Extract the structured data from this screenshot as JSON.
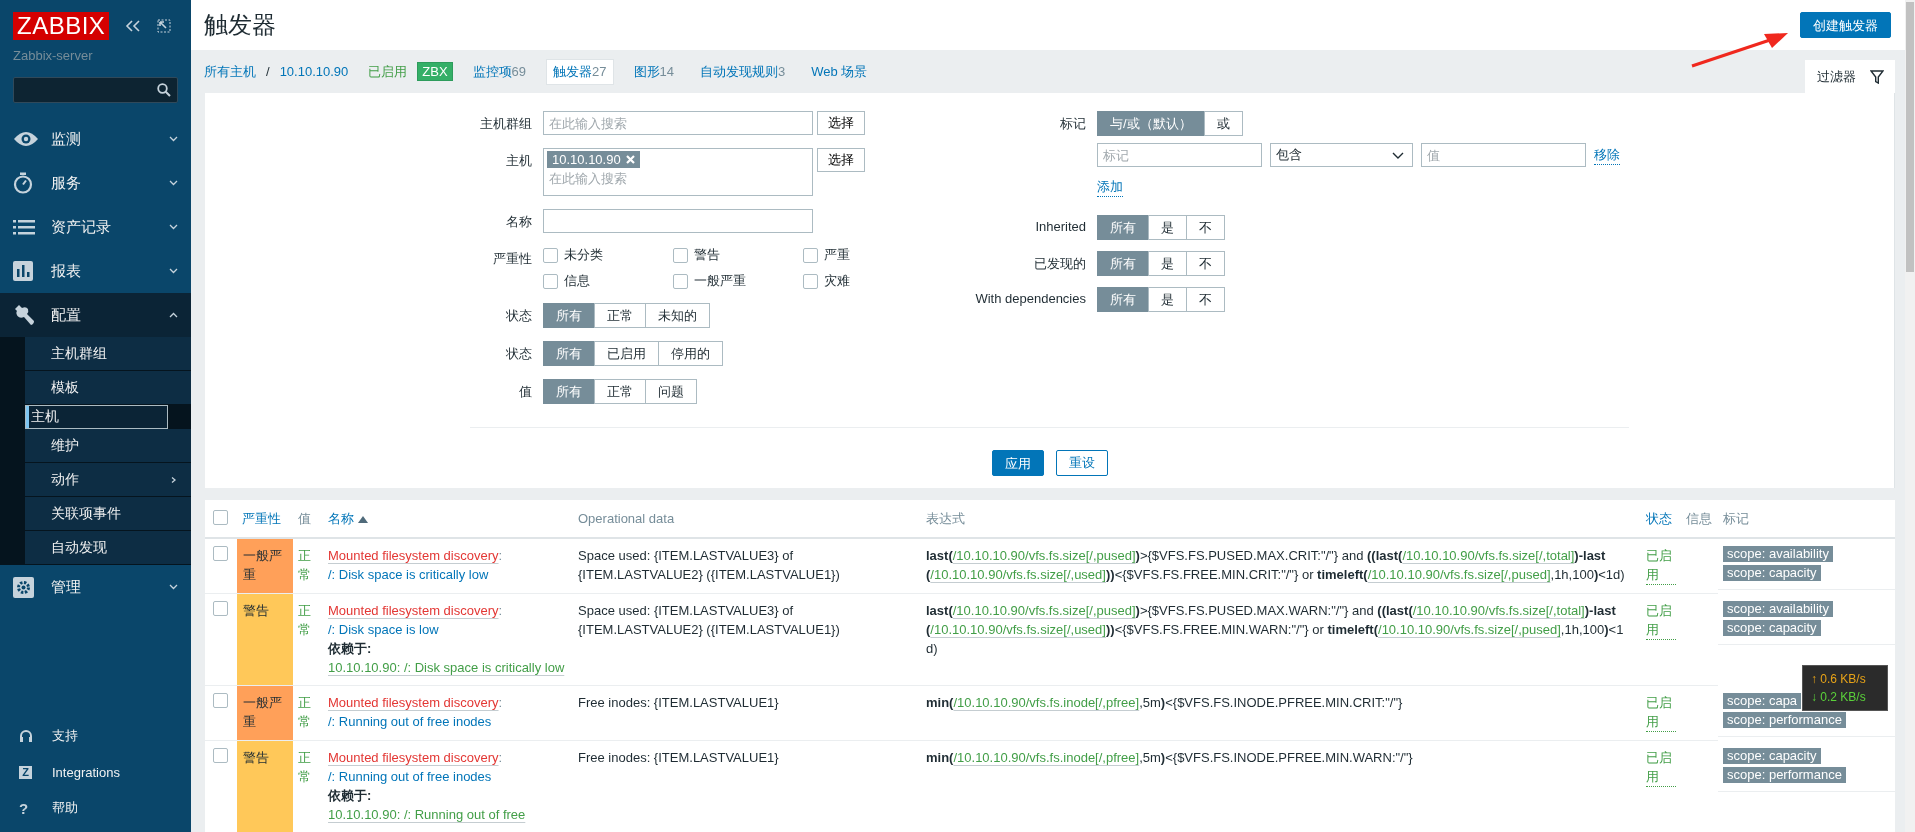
{
  "sidebar": {
    "logo": "ZABBIX",
    "server": "Zabbix-server",
    "menu": [
      {
        "label": "监测",
        "expanded": false
      },
      {
        "label": "服务",
        "expanded": false
      },
      {
        "label": "资产记录",
        "expanded": false
      },
      {
        "label": "报表",
        "expanded": false
      },
      {
        "label": "配置",
        "expanded": true,
        "children": [
          {
            "label": "主机群组",
            "selected": false,
            "has_submenu": false
          },
          {
            "label": "模板",
            "selected": false,
            "has_submenu": false
          },
          {
            "label": "主机",
            "selected": true,
            "has_submenu": false
          },
          {
            "label": "维护",
            "selected": false,
            "has_submenu": false
          },
          {
            "label": "动作",
            "selected": false,
            "has_submenu": true
          },
          {
            "label": "关联项事件",
            "selected": false,
            "has_submenu": false
          },
          {
            "label": "自动发现",
            "selected": false,
            "has_submenu": false
          }
        ]
      },
      {
        "label": "管理",
        "expanded": false
      }
    ],
    "bottom": [
      {
        "label": "支持"
      },
      {
        "label": "Integrations",
        "glyph": "Z"
      },
      {
        "label": "帮助",
        "glyph": "?"
      }
    ]
  },
  "header": {
    "title": "触发器",
    "create_button": "创建触发器"
  },
  "nav": {
    "breadcrumbs": [
      "所有主机",
      "10.10.10.90"
    ],
    "separator": "/",
    "status": "已启用",
    "badge": "ZBX",
    "tabs": [
      {
        "label": "监控项",
        "count": "69",
        "selected": false
      },
      {
        "label": "触发器",
        "count": "27",
        "selected": true
      },
      {
        "label": "图形",
        "count": "14",
        "selected": false
      },
      {
        "label": "自动发现规则",
        "count": "3",
        "selected": false
      },
      {
        "label": "Web 场景",
        "selected": false
      }
    ],
    "filter_tab": "过滤器"
  },
  "filter": {
    "host_group": {
      "label": "主机群组",
      "placeholder": "在此输入搜索",
      "button": "选择"
    },
    "host": {
      "label": "主机",
      "chips": [
        "10.10.10.90"
      ],
      "placeholder": "在此输入搜索",
      "button": "选择"
    },
    "name": {
      "label": "名称"
    },
    "severity": {
      "label": "严重性",
      "options": [
        {
          "label": "未分类",
          "checked": false
        },
        {
          "label": "警告",
          "checked": false
        },
        {
          "label": "严重",
          "checked": false
        },
        {
          "label": "信息",
          "checked": false
        },
        {
          "label": "一般严重",
          "checked": false
        },
        {
          "label": "灾难",
          "checked": false
        }
      ]
    },
    "segments_left": [
      {
        "label": "状态",
        "options": [
          {
            "label": "所有",
            "selected": true
          },
          {
            "label": "正常",
            "selected": false
          },
          {
            "label": "未知的",
            "selected": false
          }
        ]
      },
      {
        "label": "状态",
        "options": [
          {
            "label": "所有",
            "selected": true
          },
          {
            "label": "已启用",
            "selected": false
          },
          {
            "label": "停用的",
            "selected": false
          }
        ]
      },
      {
        "label": "值",
        "options": [
          {
            "label": "所有",
            "selected": true
          },
          {
            "label": "正常",
            "selected": false
          },
          {
            "label": "问题",
            "selected": false
          }
        ]
      }
    ],
    "tags": {
      "label": "标记",
      "options": [
        {
          "label": "与/或（默认）",
          "selected": true
        },
        {
          "label": "或",
          "selected": false
        }
      ],
      "tag_placeholder": "标记",
      "operator": "包含",
      "value_placeholder": "值",
      "remove": "移除",
      "add": "添加"
    },
    "segments_right": [
      {
        "label": "Inherited",
        "options": [
          {
            "label": "所有",
            "selected": true
          },
          {
            "label": "是",
            "selected": false
          },
          {
            "label": "不",
            "selected": false
          }
        ]
      },
      {
        "label": "已发现的",
        "options": [
          {
            "label": "所有",
            "selected": true
          },
          {
            "label": "是",
            "selected": false
          },
          {
            "label": "不",
            "selected": false
          }
        ]
      },
      {
        "label": "With dependencies",
        "options": [
          {
            "label": "所有",
            "selected": true
          },
          {
            "label": "是",
            "selected": false
          },
          {
            "label": "不",
            "selected": false
          }
        ]
      }
    ],
    "apply": "应用",
    "reset": "重设"
  },
  "table": {
    "select_all": {
      "checked": false
    },
    "columns": [
      {
        "label": "严重性",
        "sortable": true
      },
      {
        "label": "值",
        "sortable": false
      },
      {
        "label": "名称",
        "sortable": true,
        "sort_ascending": true
      },
      {
        "label": "Operational data",
        "sortable": false
      },
      {
        "label": "表达式",
        "sortable": false
      },
      {
        "label": "状态",
        "sortable": true
      },
      {
        "label": "信息",
        "sortable": false
      },
      {
        "label": "标记",
        "sortable": false
      }
    ],
    "rows": [
      {
        "checked": false,
        "severity": "一般严重",
        "color": "#ffa059",
        "value": "正常",
        "template": "Mounted filesystem discovery",
        "separator": ":",
        "name": "/: Disk space is critically low",
        "opdata": "Space used: {ITEM.LASTVALUE3} of {ITEM.LASTVALUE2} ({ITEM.LASTVALUE1})",
        "expression": [
          {
            "kind": "fn",
            "text": "last("
          },
          {
            "kind": "item",
            "text": "/10.10.10.90/vfs.fs.size[/,pused]"
          },
          {
            "kind": "fn",
            "text": ")"
          },
          {
            "kind": "text",
            "text": ">{$VFS.FS.PUSED.MAX.CRIT:\"/\"} and "
          },
          {
            "kind": "fn",
            "text": "((last("
          },
          {
            "kind": "item",
            "text": "/10.10.10.90/vfs.fs.size[/,total]"
          },
          {
            "kind": "fn",
            "text": ")-last("
          },
          {
            "kind": "item",
            "text": "/10.10.10.90/vfs.fs.size[/,used]"
          },
          {
            "kind": "fn",
            "text": "))"
          },
          {
            "kind": "text",
            "text": "<{$VFS.FS.FREE.MIN.CRIT:\"/\"} or "
          },
          {
            "kind": "fn",
            "text": "timeleft("
          },
          {
            "kind": "item",
            "text": "/10.10.10.90/vfs.fs.size[/,pused]"
          },
          {
            "kind": "text",
            "text": ",1h,100"
          },
          {
            "kind": "fn",
            "text": ")"
          },
          {
            "kind": "text",
            "text": "<1d)"
          }
        ],
        "status": "已启用",
        "tags": [
          "scope: availability",
          "scope: capacity"
        ]
      },
      {
        "checked": false,
        "severity": "警告",
        "color": "#ffc859",
        "value": "正常",
        "template": "Mounted filesystem discovery",
        "separator": ":",
        "name": "/: Disk space is low",
        "depends_label": "依赖于:",
        "depends": [
          "10.10.10.90: /: Disk space is critically low"
        ],
        "opdata": "Space used: {ITEM.LASTVALUE3} of {ITEM.LASTVALUE2} ({ITEM.LASTVALUE1})",
        "expression": [
          {
            "kind": "fn",
            "text": "last("
          },
          {
            "kind": "item",
            "text": "/10.10.10.90/vfs.fs.size[/,pused]"
          },
          {
            "kind": "fn",
            "text": ")"
          },
          {
            "kind": "text",
            "text": ">{$VFS.FS.PUSED.MAX.WARN:\"/\"} and "
          },
          {
            "kind": "fn",
            "text": "((last("
          },
          {
            "kind": "item",
            "text": "/10.10.10.90/vfs.fs.size[/,total]"
          },
          {
            "kind": "fn",
            "text": ")-last("
          },
          {
            "kind": "item",
            "text": "/10.10.10.90/vfs.fs.size[/,used]"
          },
          {
            "kind": "fn",
            "text": "))"
          },
          {
            "kind": "text",
            "text": "<{$VFS.FS.FREE.MIN.WARN:\"/\"} or "
          },
          {
            "kind": "fn",
            "text": "timeleft("
          },
          {
            "kind": "item",
            "text": "/10.10.10.90/vfs.fs.size[/,pused]"
          },
          {
            "kind": "text",
            "text": ",1h,100"
          },
          {
            "kind": "fn",
            "text": ")"
          },
          {
            "kind": "text",
            "text": "<1d)"
          }
        ],
        "status": "已启用",
        "tags": [
          "scope: availability",
          "scope: capacity"
        ]
      },
      {
        "checked": false,
        "severity": "一般严重",
        "color": "#ffa059",
        "value": "正常",
        "template": "Mounted filesystem discovery",
        "separator": ":",
        "name": "/: Running out of free inodes",
        "opdata": "Free inodes: {ITEM.LASTVALUE1}",
        "expression": [
          {
            "kind": "fn",
            "text": "min("
          },
          {
            "kind": "item",
            "text": "/10.10.10.90/vfs.fs.inode[/,pfree]"
          },
          {
            "kind": "text",
            "text": ",5m"
          },
          {
            "kind": "fn",
            "text": ")"
          },
          {
            "kind": "text",
            "text": "<{$VFS.FS.INODE.PFREE.MIN.CRIT:\"/\"}"
          }
        ],
        "status": "已启用",
        "tags": [
          "scope: capa",
          "scope: performance"
        ]
      },
      {
        "checked": false,
        "severity": "警告",
        "color": "#ffc859",
        "value": "正常",
        "template": "Mounted filesystem discovery",
        "separator": ":",
        "name": "/: Running out of free inodes",
        "depends_label": "依赖于:",
        "depends": [
          "10.10.10.90: /: Running out of free"
        ],
        "opdata": "Free inodes: {ITEM.LASTVALUE1}",
        "expression": [
          {
            "kind": "fn",
            "text": "min("
          },
          {
            "kind": "item",
            "text": "/10.10.10.90/vfs.fs.inode[/,pfree]"
          },
          {
            "kind": "text",
            "text": ",5m"
          },
          {
            "kind": "fn",
            "text": ")"
          },
          {
            "kind": "text",
            "text": "<{$VFS.FS.INODE.PFREE.MIN.WARN:\"/\"}"
          }
        ],
        "status": "已启用",
        "tags": [
          "scope: capacity",
          "scope: performance"
        ]
      }
    ]
  },
  "net_monitor": {
    "up": "↑ 0.6 KB/s",
    "down": "↓ 0.2 KB/s"
  }
}
